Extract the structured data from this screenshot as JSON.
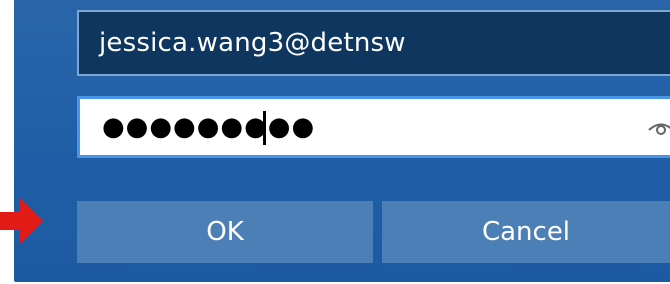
{
  "login": {
    "username_value": "jessica.wang3@detnsw",
    "password_masked": "●●●●●●●●●"
  },
  "buttons": {
    "ok_label": "OK",
    "cancel_label": "Cancel"
  },
  "icons": {
    "password_reveal": "eye-icon",
    "pointer": "red-arrow-icon"
  },
  "colors": {
    "dialog_bg": "#1f5ea6",
    "field_dark": "#0e365f",
    "focus_border": "#4b95e8",
    "button_bg": "#4d7fb7",
    "arrow": "#e21b16"
  }
}
